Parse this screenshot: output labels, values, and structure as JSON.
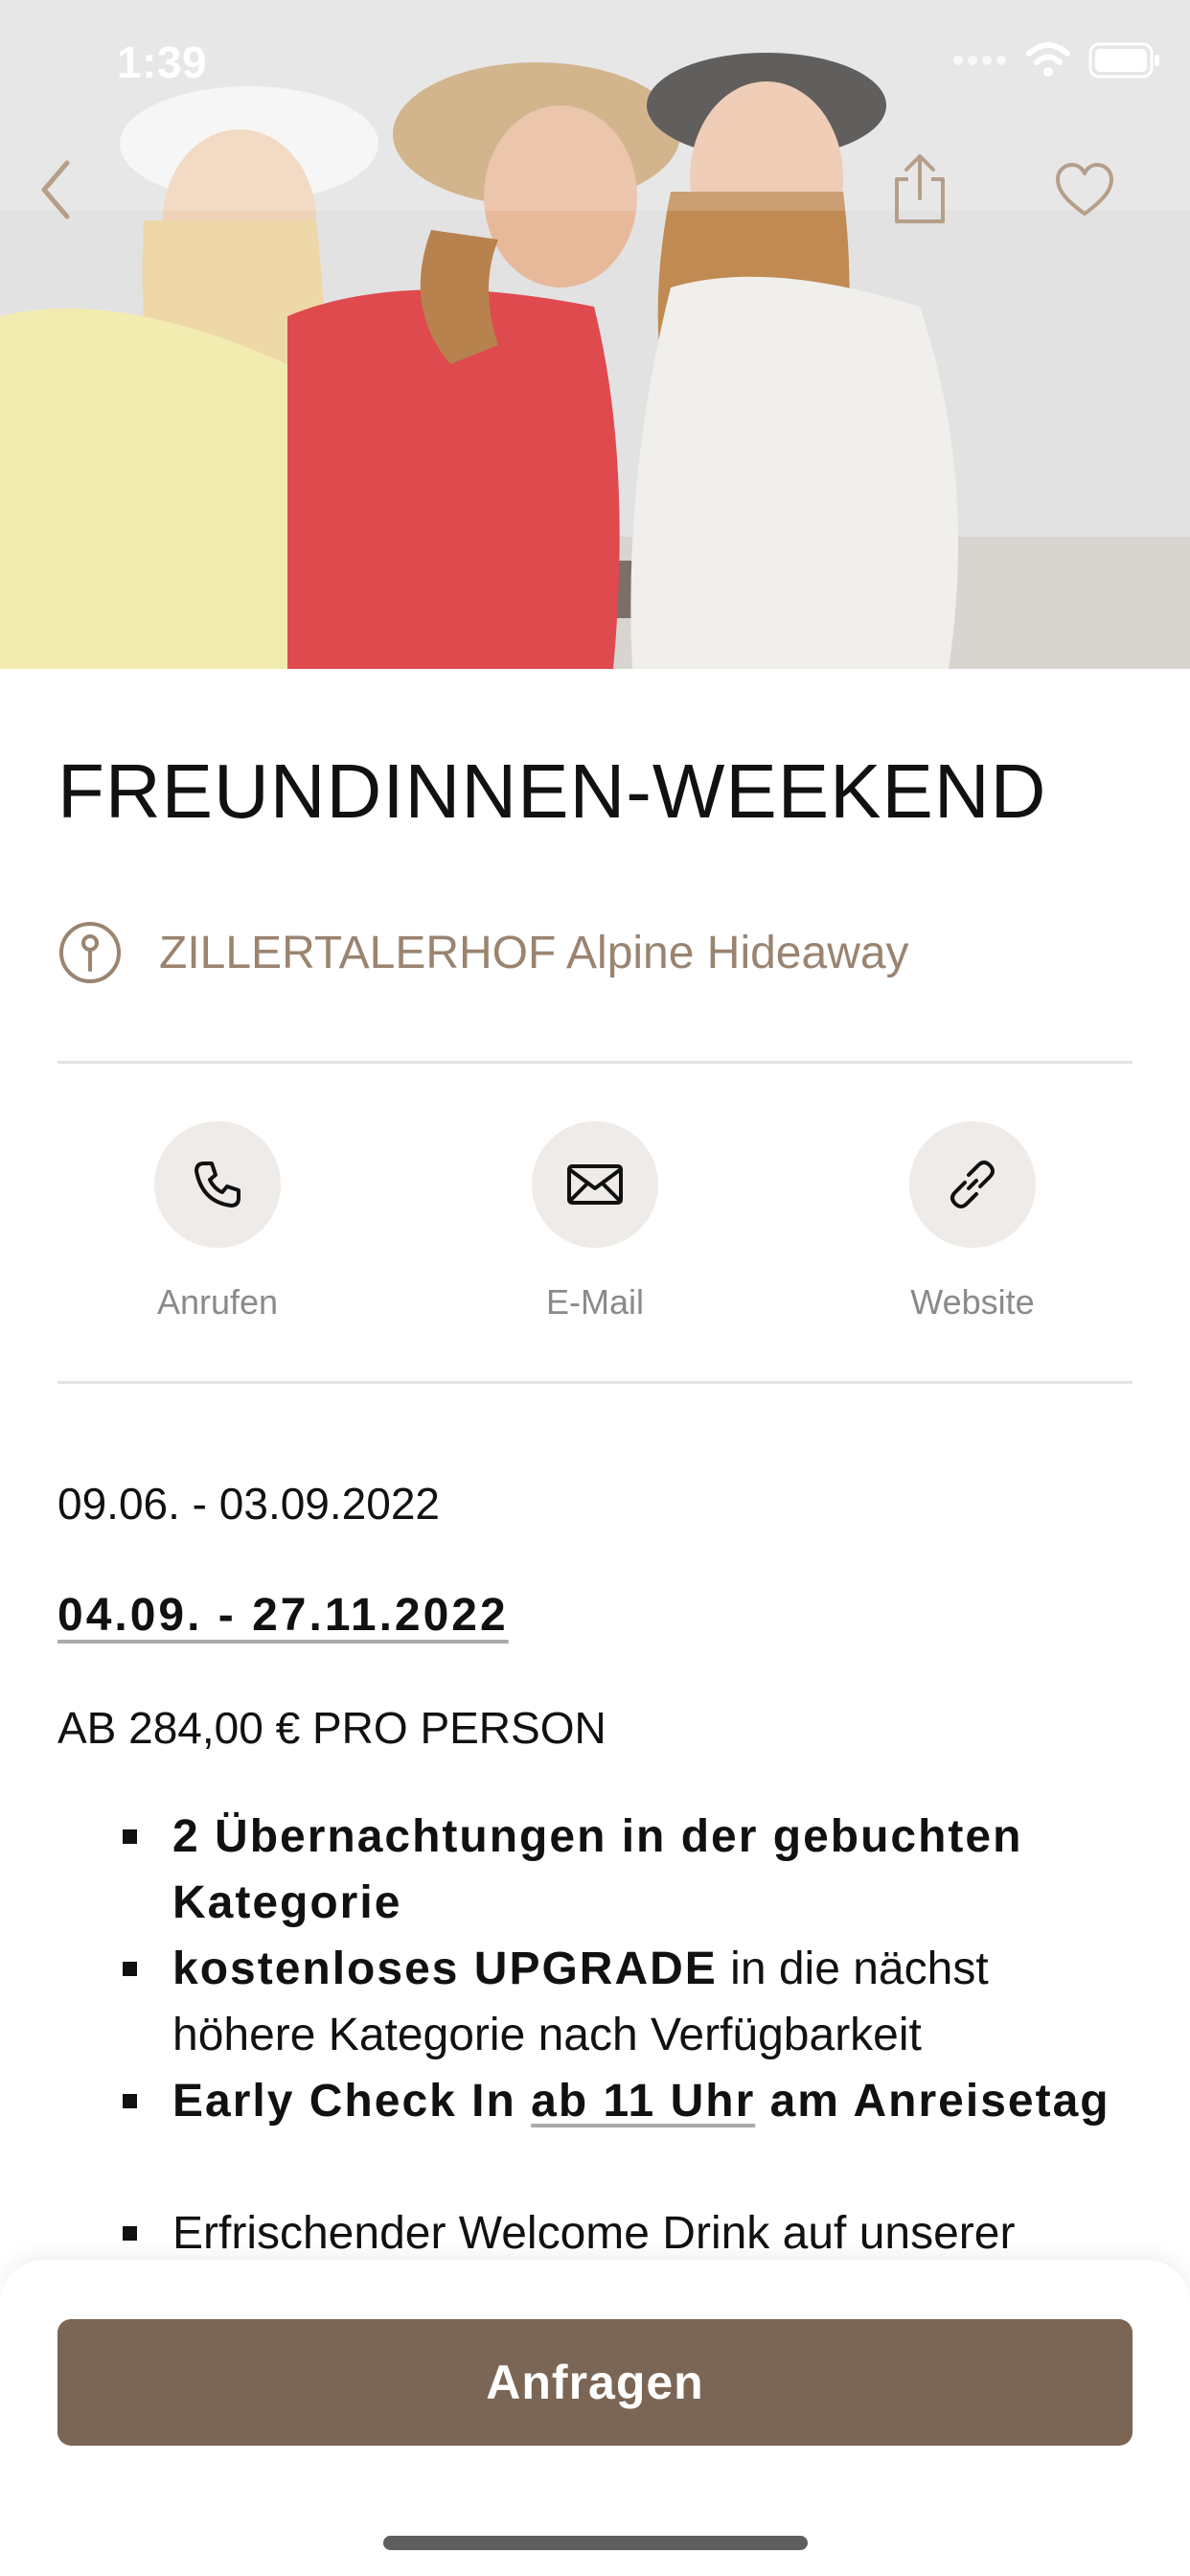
{
  "status_bar": {
    "time": "1:39"
  },
  "hero": {
    "image": "three-women-wearing-sun-hats-laughing-photo"
  },
  "nav": {
    "back_icon": "chevron-left-icon",
    "share_icon": "share-icon",
    "favorite_icon": "heart-icon"
  },
  "offer": {
    "title": "FREUNDINNEN-WEEKEND",
    "location": "ZILLERTALERHOF Alpine Hideaway"
  },
  "actions": [
    {
      "label": "Anrufen",
      "icon": "phone-icon"
    },
    {
      "label": "E-Mail",
      "icon": "mail-icon"
    },
    {
      "label": "Website",
      "icon": "link-icon"
    }
  ],
  "details": {
    "date_range_1": "09.06. - 03.09.2022",
    "date_range_2": "04.09. - 27.11.2022",
    "price": "AB 284,00 € PRO PERSON"
  },
  "features": {
    "f1_bold": "2 Übernachtungen in der gebuchten Kategorie",
    "f2_bold": "kostenloses UPGRADE",
    "f2_rest": " in die nächst höhere Kategorie nach Verfügbarkeit",
    "f3_part1": "Early Check In ",
    "f3_underlined": "ab 11 Uhr",
    "f3_part2": " am Anreisetag",
    "f4": "Erfrischender Welcome Drink  auf unserer"
  },
  "cta": {
    "label": "Anfragen"
  },
  "colors": {
    "accent": "#7b6554",
    "location_text": "#9a8470",
    "action_circle": "#eeebe8"
  }
}
